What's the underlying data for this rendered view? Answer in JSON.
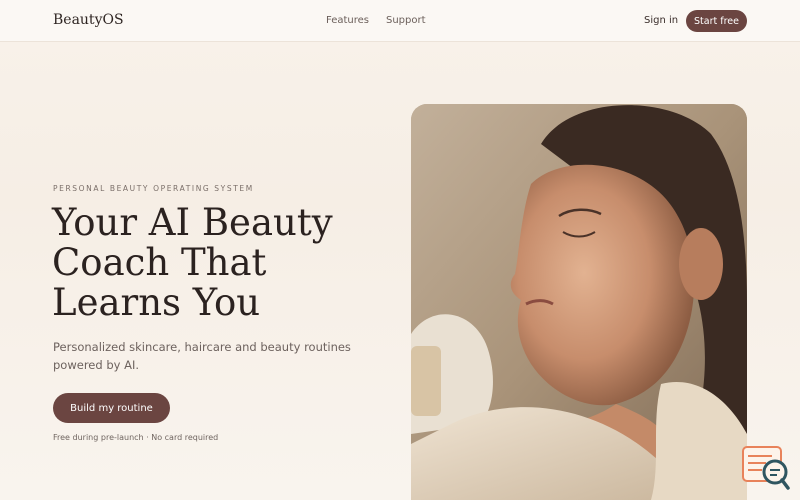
{
  "nav": {
    "logo": "BeautyOS",
    "links": [
      "Features",
      "Support"
    ],
    "sign_in": "Sign in",
    "start_free": "Start free"
  },
  "hero": {
    "eyebrow": "PERSONAL BEAUTY OPERATING SYSTEM",
    "headline": "Your AI Beauty Coach That Learns You",
    "subtitle": "Personalized skincare, haircare and beauty routines powered by AI.",
    "cta": "Build my routine",
    "note": "Free during pre-launch · No card required"
  },
  "colors": {
    "accent": "#6b4541",
    "background": "#f8f2ea",
    "text": "#2b2220"
  },
  "icons": {
    "widget": "search-chat-icon"
  }
}
